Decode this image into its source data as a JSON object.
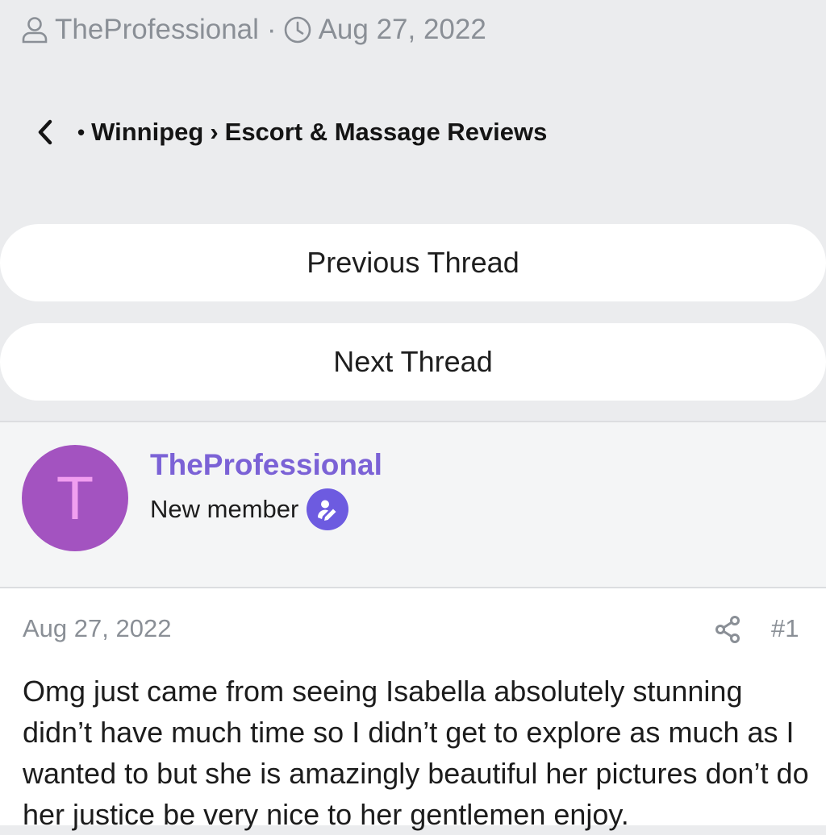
{
  "thread_meta": {
    "author": "TheProfessional",
    "separator": "·",
    "date": "Aug 27, 2022"
  },
  "breadcrumb": {
    "bullet": "•",
    "items": [
      "Winnipeg",
      "Escort & Massage Reviews"
    ],
    "separator": "›"
  },
  "thread_nav": {
    "previous_label": "Previous Thread",
    "next_label": "Next Thread"
  },
  "author_block": {
    "avatar_letter": "T",
    "name": "TheProfessional",
    "role": "New member"
  },
  "post": {
    "date": "Aug 27, 2022",
    "number": "#1",
    "body": "Omg just came from seeing Isabella absolutely stunning didn’t have much time so I didn’t get to explore as much as I wanted to but she is amazingly beautiful her pictures don’t do her justice be very nice to her gentlemen enjoy."
  },
  "icons": {
    "author": "user-icon",
    "date": "clock-icon",
    "back": "chevron-left-icon",
    "role_badge": "user-edit-icon",
    "share": "share-icon"
  },
  "colors": {
    "background": "#ebecee",
    "author_name": "#7b62d6",
    "avatar_bg": "#a353c0",
    "avatar_letter": "#f19ef0",
    "badge_bg": "#6d5be0",
    "muted_text": "#8a8f96"
  }
}
